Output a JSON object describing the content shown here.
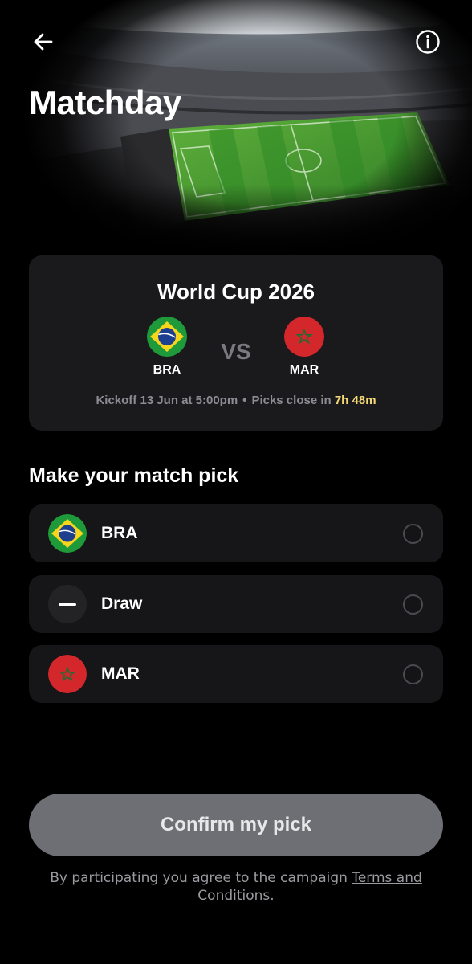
{
  "header": {
    "title": "Matchday",
    "back_icon": "arrow-left-icon",
    "info_icon": "info-icon"
  },
  "match": {
    "competition": "World Cup 2026",
    "home": {
      "code": "BRA",
      "flag_icon": "brazil-flag-icon"
    },
    "away": {
      "code": "MAR",
      "flag_icon": "morocco-flag-icon"
    },
    "vs_label": "VS",
    "kickoff_text": "Kickoff 13 Jun at 5:00pm",
    "separator": "•",
    "picks_close_label": "Picks close in",
    "picks_close_countdown": "7h 48m"
  },
  "pick": {
    "heading": "Make your match pick",
    "options": [
      {
        "label": "BRA",
        "icon": "brazil-flag-icon",
        "selected": false
      },
      {
        "label": "Draw",
        "icon": "dash-icon",
        "selected": false
      },
      {
        "label": "MAR",
        "icon": "morocco-flag-icon",
        "selected": false
      }
    ]
  },
  "footer": {
    "confirm_label": "Confirm my pick",
    "terms_prefix": "By participating you agree to the campaign",
    "terms_link": "Terms and Conditions."
  },
  "colors": {
    "background": "#000000",
    "card": "#1a1a1d",
    "option": "#161618",
    "countdown": "#f5d977",
    "button": "#6d6f75",
    "muted_text": "#8c8c92"
  }
}
